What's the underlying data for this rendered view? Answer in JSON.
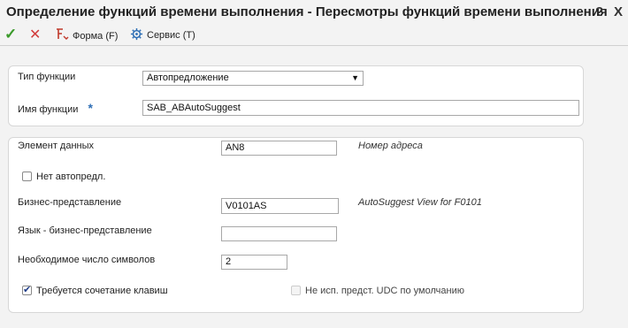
{
  "window": {
    "title": "Определение функций времени выполнения - Пересмотры функций времени выполнения",
    "help_icon": "?",
    "close_icon": "X"
  },
  "toolbar": {
    "ok_icon": "✓",
    "cancel_icon": "✕",
    "form_label": "Форма (F)",
    "service_label": "Сервис (T)"
  },
  "section1": {
    "function_type_label": "Тип функции",
    "function_type_value": "Автопредложение",
    "function_name_label": "Имя функции",
    "required_marker": "*",
    "function_name_value": "SAB_ABAutoSuggest"
  },
  "section2": {
    "data_item_label": "Элемент данных",
    "data_item_value": "AN8",
    "data_item_desc": "Номер адреса",
    "no_autosuggest_label": "Нет автопредл.",
    "no_autosuggest_checked": false,
    "business_view_label": "Бизнес-представление",
    "business_view_value": "V0101AS",
    "business_view_desc": "AutoSuggest View for F0101",
    "language_view_label": "Язык - бизнес-представление",
    "language_view_value": "",
    "min_chars_label": "Необходимое число символов",
    "min_chars_value": "2",
    "hotkey_label": "Требуется сочетание клавиш",
    "hotkey_checked": true,
    "no_udc_label": "Не исп. предст. UDC по умолчанию",
    "no_udc_checked": false
  },
  "colors": {
    "ok_green": "#3a9a2a",
    "cancel_red": "#d23c3c",
    "required_blue": "#2f6fb5"
  }
}
